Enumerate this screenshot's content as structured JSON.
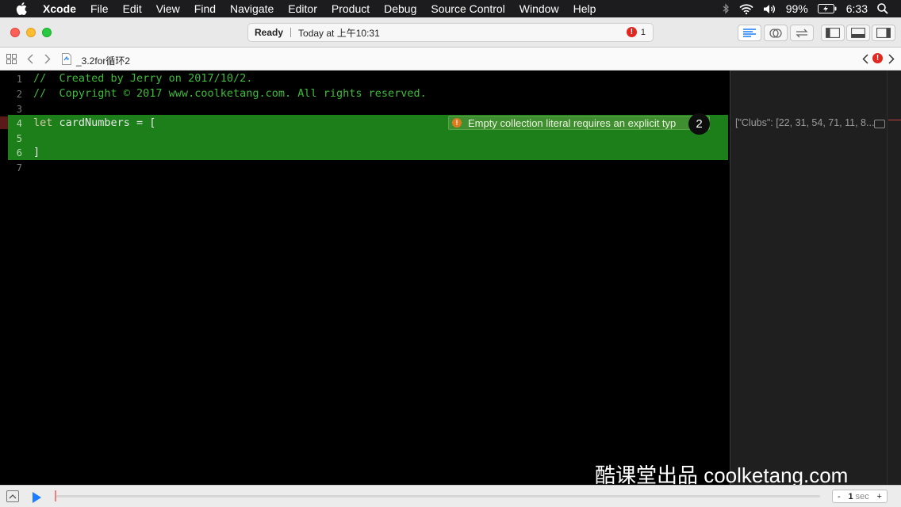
{
  "menubar": {
    "app": "Xcode",
    "items": [
      "File",
      "Edit",
      "View",
      "Find",
      "Navigate",
      "Editor",
      "Product",
      "Debug",
      "Source Control",
      "Window",
      "Help"
    ],
    "battery": "99%",
    "time": "6:33",
    "icons": [
      "apple-icon",
      "bluetooth-icon",
      "wifi-icon",
      "volume-icon",
      "battery-icon",
      "search-icon"
    ]
  },
  "toolbar": {
    "status": "Ready",
    "timestamp": "Today at 上午10:31",
    "error_count": "1"
  },
  "jumpbar": {
    "filename": "_3.2for循环2",
    "error_glyph": "!"
  },
  "editor": {
    "lines": [
      {
        "num": "1",
        "text": "//  Created by Jerry on 2017/10/2."
      },
      {
        "num": "2",
        "text": "//  Copyright © 2017 www.coolketang.com. All rights reserved."
      },
      {
        "num": "3",
        "text": ""
      },
      {
        "num": "4",
        "kw": "let",
        "rest": " cardNumbers = ["
      },
      {
        "num": "5",
        "text": ""
      },
      {
        "num": "6",
        "text": "]"
      },
      {
        "num": "7",
        "text": ""
      }
    ],
    "error_message": "Empty collection literal requires an explicit typ",
    "error_glyph": "!",
    "badge": "2"
  },
  "results": {
    "value": "[\"Clubs\": [22, 31, 54, 71, 11, 8..."
  },
  "watermark": "酷课堂出品 coolketang.com",
  "debugbar": {
    "minus": "-",
    "seconds": "1",
    "unit": "sec",
    "plus": "+"
  },
  "colors": {
    "comment": "#3fbb3a",
    "error_highlight": "#1c7f1a",
    "error_red": "#e2281e",
    "accent_blue": "#1a7dff"
  }
}
